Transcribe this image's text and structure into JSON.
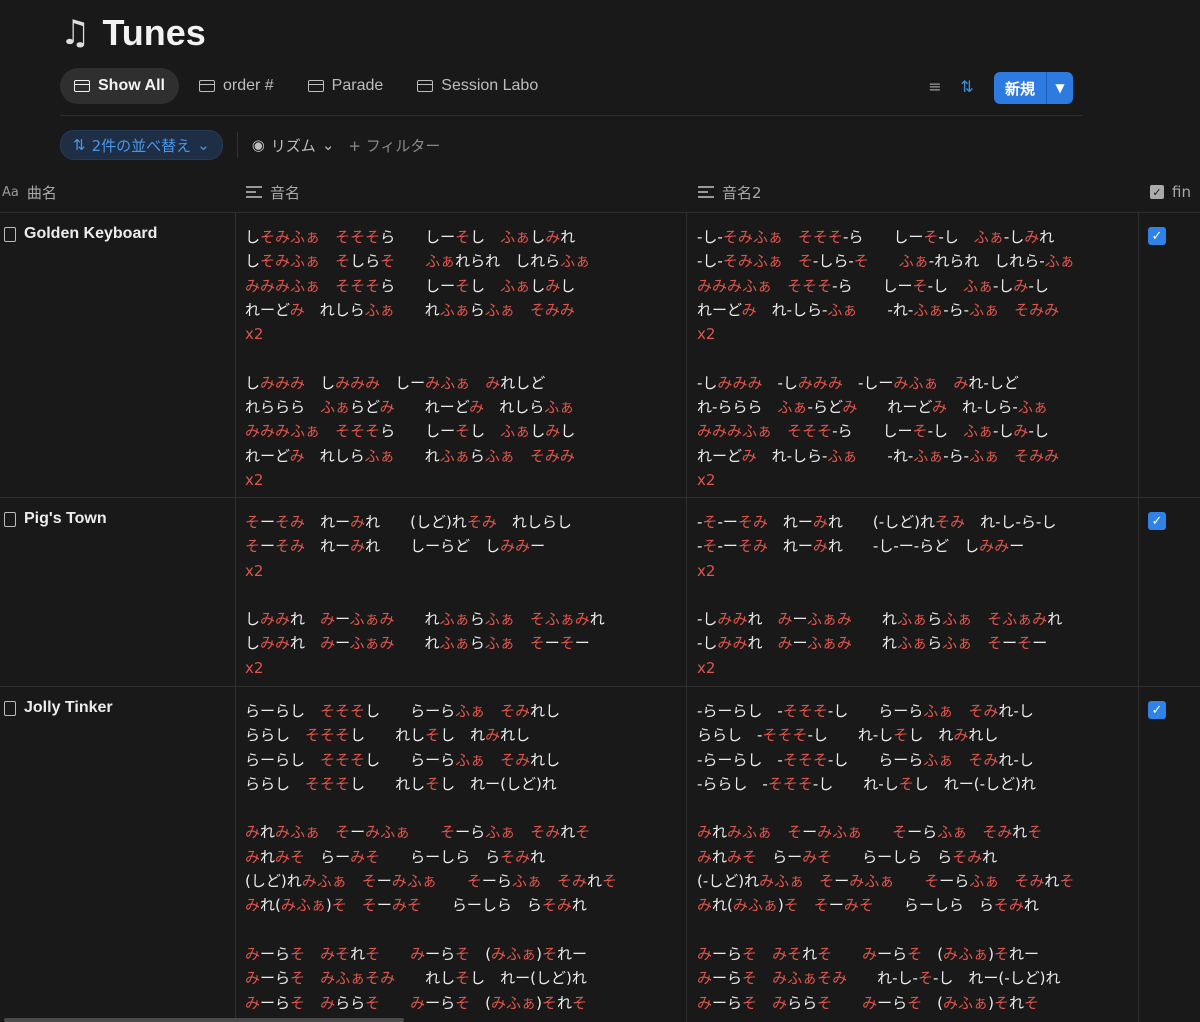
{
  "app": {
    "title": "Tunes",
    "title_icon": "musical-notes-icon"
  },
  "tabs": [
    {
      "label": "Show All",
      "active": true
    },
    {
      "label": "order #",
      "active": false
    },
    {
      "label": "Parade",
      "active": false
    },
    {
      "label": "Session Labo",
      "active": false
    }
  ],
  "toolbar": {
    "new_label": "新規"
  },
  "filters": {
    "sort_label": "2件の並べ替え",
    "rhythm_label": "リズム",
    "add_filter_label": "+ フィルター"
  },
  "columns": {
    "name": "曲名",
    "notes": "音名",
    "notes2": "音名2",
    "fin": "fin"
  },
  "colors": {
    "accent": "#2e82e8",
    "note_red": "#e0554c",
    "background": "#191919"
  },
  "rows": [
    {
      "name": "Golden Keyboard",
      "fin": true,
      "notes": "しそみふぁ　そそそら　　しーそし　ふぁしみれ\nしそみふぁ　そしらそ　　ふぁれられ　しれらふぁ\nみみみふぁ　そそそら　　しーそし　ふぁしみし\nれーどみ　れしらふぁ　　れふぁらふぁ　そみみ\nx2\n\nしみみみ　しみみみ　しーみふぁ　みれしど\nれららら　ふぁらどみ　　れーどみ　れしらふぁ\nみみみふぁ　そそそら　　しーそし　ふぁしみし\nれーどみ　れしらふぁ　　れふぁらふぁ　そみみ\nx2",
      "notes2": "-し-そみふぁ　そそそ-ら　　しーそ-し　ふぁ-しみれ\n-し-そみふぁ　そ-しら-そ　　ふぁ-れられ　しれら-ふぁ\nみみみふぁ　そそそ-ら　　しーそ-し　ふぁ-しみ-し\nれーどみ　れ-しら-ふぁ　　-れ-ふぁ-ら-ふぁ　そみみ\nx2\n\n-しみみみ　-しみみみ　-しーみふぁ　みれ-しど\nれ-ららら　ふぁ-らどみ　　れーどみ　れ-しら-ふぁ\nみみみふぁ　そそそ-ら　　しーそ-し　ふぁ-しみ-し\nれーどみ　れ-しら-ふぁ　　-れ-ふぁ-ら-ふぁ　そみみ\nx2"
    },
    {
      "name": "Pig's Town",
      "fin": true,
      "notes": "そーそみ　れーみれ　　(しど)れそみ　れしらし\nそーそみ　れーみれ　　しーらど　しみみー\nx2\n\nしみみれ　みーふぁみ　　れふぁらふぁ　そふぁみれ\nしみみれ　みーふぁみ　　れふぁらふぁ　そーそー\nx2",
      "notes2": "-そ-ーそみ　れーみれ　　(-しど)れそみ　れ-し-ら-し\n-そ-ーそみ　れーみれ　　-し-ー-らど　しみみー\nx2\n\n-しみみれ　みーふぁみ　　れふぁらふぁ　そふぁみれ\n-しみみれ　みーふぁみ　　れふぁらふぁ　そーそー\nx2"
    },
    {
      "name": "Jolly Tinker",
      "fin": true,
      "notes": "らーらし　そそそし　　らーらふぁ　そみれし\nららし　そそそし　　れしそし　れみれし\nらーらし　そそそし　　らーらふぁ　そみれし\nららし　そそそし　　れしそし　れー(しど)れ\n\nみれみふぁ　そーみふぁ　　そーらふぁ　そみれそ\nみれみそ　らーみそ　　らーしら　らそみれ\n(しど)れみふぁ　そーみふぁ　　そーらふぁ　そみれそ\nみれ(みふぁ)そ　そーみそ　　らーしら　らそみれ\n\nみーらそ　みそれそ　　みーらそ　(みふぁ)それー\nみーらそ　みふぁそみ　　れしそし　れー(しど)れ\nみーらそ　みららそ　　みーらそ　(みふぁ)それそ",
      "notes2": "-らーらし　-そそそ-し　　らーらふぁ　そみれ-し\nららし　-そそそ-し　　れ-しそし　れみれし\n-らーらし　-そそそ-し　　らーらふぁ　そみれ-し\n-ららし　-そそそ-し　　れ-しそし　れー(-しど)れ\n\nみれみふぁ　そーみふぁ　　そーらふぁ　そみれそ\nみれみそ　らーみそ　　らーしら　らそみれ\n(-しど)れみふぁ　そーみふぁ　　そーらふぁ　そみれそ\nみれ(みふぁ)そ　そーみそ　　らーしら　らそみれ\n\nみーらそ　みそれそ　　みーらそ　(みふぁ)それー\nみーらそ　みふぁそみ　　れ-し-そ-し　れー(-しど)れ\nみーらそ　みららそ　　みーらそ　(みふぁ)それそ"
    }
  ]
}
